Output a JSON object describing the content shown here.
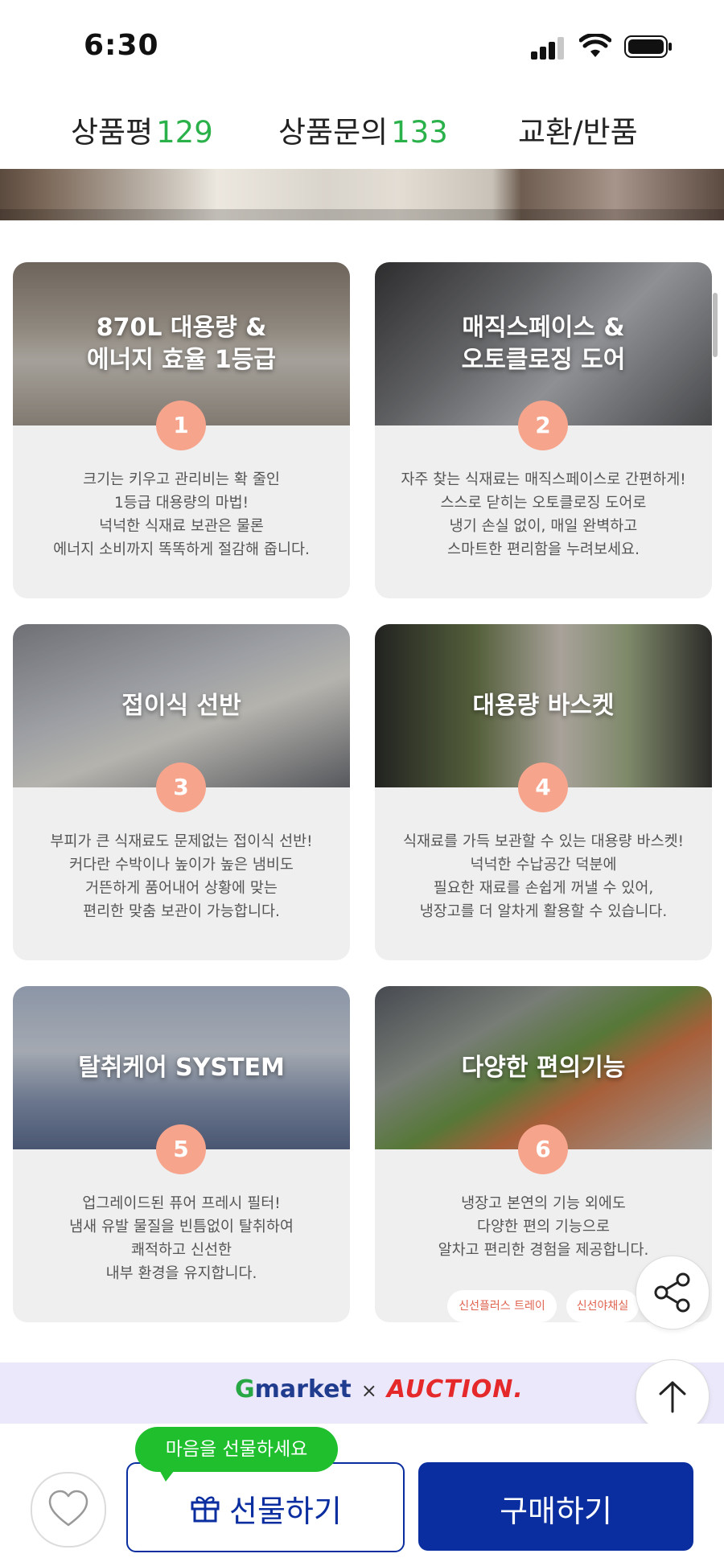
{
  "status_bar": {
    "time": "6:30"
  },
  "tabs": [
    {
      "label": "상품평",
      "count": "129"
    },
    {
      "label": "상품문의",
      "count": "133"
    },
    {
      "label": "교환/반품",
      "count": ""
    }
  ],
  "features": [
    {
      "number": "1",
      "title": "870L 대용량 &\n에너지 효율 1등급",
      "description": "크기는 키우고 관리비는 확 줄인\n1등급 대용량의 마법!\n넉넉한 식재료 보관은 물론\n에너지 소비까지 똑똑하게 절감해 줍니다."
    },
    {
      "number": "2",
      "title": "매직스페이스 &\n오토클로징 도어",
      "description": "자주 찾는 식재료는 매직스페이스로 간편하게!\n스스로 닫히는 오토클로징 도어로\n냉기 손실 없이, 매일 완벽하고\n스마트한 편리함을 누려보세요."
    },
    {
      "number": "3",
      "title": "접이식 선반",
      "description": "부피가 큰 식재료도 문제없는 접이식 선반!\n커다란 수박이나 높이가 높은 냄비도\n거뜬하게 품어내어 상황에 맞는\n편리한 맞춤 보관이 가능합니다."
    },
    {
      "number": "4",
      "title": "대용량 바스켓",
      "description": "식재료를 가득 보관할 수 있는 대용량 바스켓!\n넉넉한 수납공간 덕분에\n필요한 재료를 손쉽게 꺼낼 수 있어,\n냉장고를 더 알차게 활용할 수 있습니다."
    },
    {
      "number": "5",
      "title": "탈취케어 SYSTEM",
      "description": "업그레이드된 퓨어 프레시 필터!\n냄새 유발 물질을 빈틈없이 탈취하여\n쾌적하고 신선한\n내부 환경을 유지합니다."
    },
    {
      "number": "6",
      "title": "다양한 편의기능",
      "description": "냉장고 본연의 기능 외에도\n다양한 편의 기능으로\n알차고 편리한 경험을 제공합니다.",
      "chips": [
        "신선플러스 트레이",
        "신선야채실"
      ]
    }
  ],
  "promo": {
    "g_letter": "G",
    "g_rest": "market",
    "times": "×",
    "partner": "AUCTION."
  },
  "bottom_bar": {
    "tooltip": "마음을 선물하세요",
    "gift_label": "선물하기",
    "buy_label": "구매하기"
  },
  "colors": {
    "accent_green": "#2bb14a",
    "primary_blue": "#0a2ea0",
    "badge_salmon": "#f7a48d",
    "tooltip_green": "#1fbf2e"
  }
}
